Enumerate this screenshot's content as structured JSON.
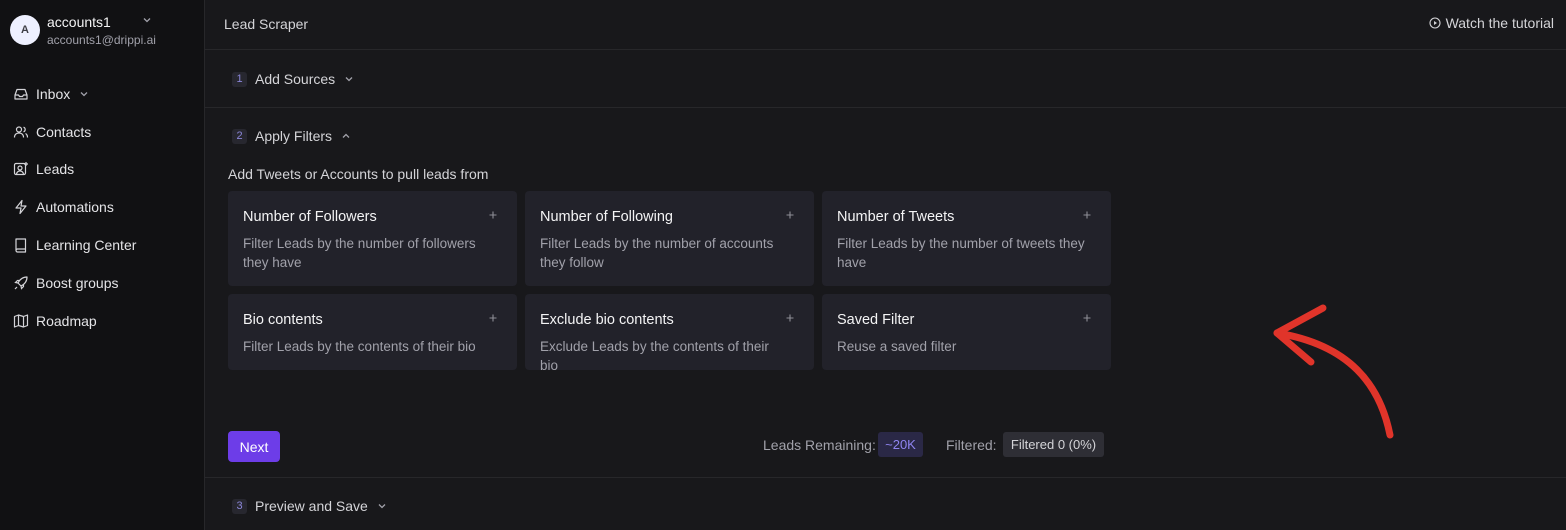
{
  "account": {
    "avatar_letter": "A",
    "name": "accounts1",
    "email": "accounts1@drippi.ai"
  },
  "sidebar": {
    "items": [
      {
        "label": "Inbox",
        "icon": "inbox-icon",
        "has_chevron": true
      },
      {
        "label": "Contacts",
        "icon": "users-icon"
      },
      {
        "label": "Leads",
        "icon": "user-plus-icon"
      },
      {
        "label": "Automations",
        "icon": "lightning-icon"
      },
      {
        "label": "Learning Center",
        "icon": "book-icon"
      },
      {
        "label": "Boost groups",
        "icon": "rocket-icon"
      },
      {
        "label": "Roadmap",
        "icon": "map-icon"
      }
    ]
  },
  "header": {
    "title": "Lead Scraper",
    "tutorial_label": "Watch the tutorial"
  },
  "steps": [
    {
      "number": "1",
      "label": "Add Sources",
      "expanded": false
    },
    {
      "number": "2",
      "label": "Apply Filters",
      "expanded": true
    },
    {
      "number": "3",
      "label": "Preview and Save",
      "expanded": false
    }
  ],
  "filters": {
    "subtitle": "Add Tweets or Accounts to pull leads from",
    "cards": [
      {
        "title": "Number of Followers",
        "description": "Filter Leads by the number of followers they have"
      },
      {
        "title": "Number of Following",
        "description": "Filter Leads by the number of accounts they follow"
      },
      {
        "title": "Number of Tweets",
        "description": "Filter Leads by the number of tweets they have"
      },
      {
        "title": "Bio contents",
        "description": "Filter Leads by the contents of their bio"
      },
      {
        "title": "Exclude bio contents",
        "description": "Exclude Leads by the contents of their bio"
      },
      {
        "title": "Saved Filter",
        "description": "Reuse a saved filter"
      }
    ]
  },
  "footer": {
    "next_label": "Next",
    "leads_remaining_label": "Leads Remaining:",
    "leads_remaining_value": "~20K",
    "filtered_label": "Filtered:",
    "filtered_value": "Filtered 0 (0%)"
  },
  "colors": {
    "accent": "#6d3de8",
    "annotation_arrow": "#e0342a",
    "background": "#18181b",
    "card": "#22222a"
  }
}
